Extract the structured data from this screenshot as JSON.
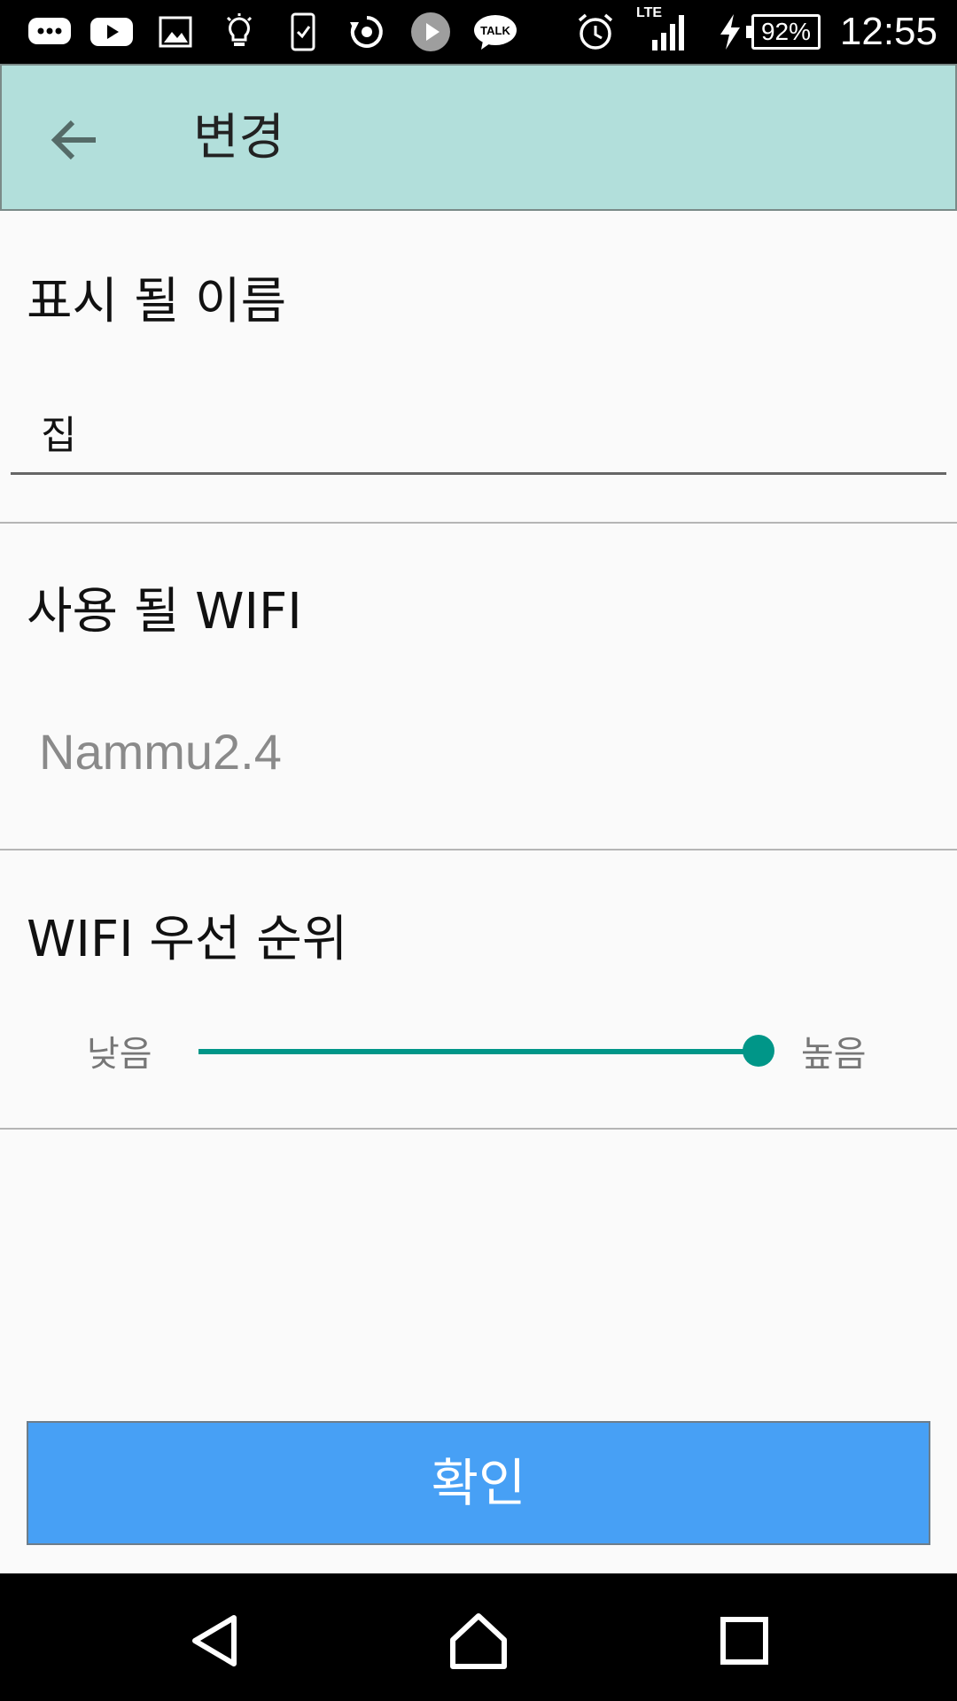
{
  "status_bar": {
    "icons": [
      "messenger-icon",
      "youtube-icon",
      "gallery-icon",
      "lightbulb-icon",
      "phone-check-icon",
      "sync-icon",
      "play-icon",
      "kakaotalk-icon",
      "alarm-icon",
      "lte-signal-icon",
      "charging-icon"
    ],
    "talk_label": "TALK",
    "network_label": "LTE",
    "battery": "92%",
    "time": "12:55"
  },
  "app_bar": {
    "title": "변경",
    "back_icon": "arrow-back-icon",
    "color": "#b2dfdb"
  },
  "name_section": {
    "title": "표시 될 이름",
    "input_value": "집"
  },
  "wifi_section": {
    "title": "사용 될 WIFI",
    "value": "Nammu2.4"
  },
  "priority_section": {
    "title": "WIFI 우선 순위",
    "low_label": "낮음",
    "high_label": "높음",
    "level": 1.0,
    "accent": "#009688"
  },
  "confirm": {
    "label": "확인",
    "color": "#47a0f5"
  },
  "nav_bar": {
    "icons": [
      "back-triangle-icon",
      "home-icon",
      "recents-icon"
    ]
  }
}
